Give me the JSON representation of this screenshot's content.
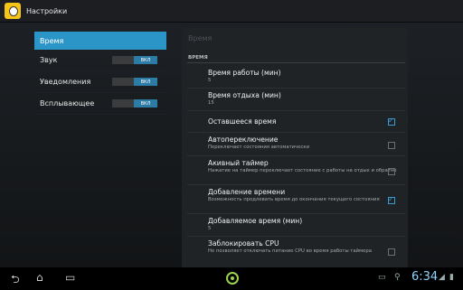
{
  "actionbar": {
    "title": "Настройки"
  },
  "left": {
    "header": "Время",
    "items": [
      {
        "label": "Звук",
        "toggle": "ВКЛ"
      },
      {
        "label": "Уведомления",
        "toggle": "ВКЛ"
      },
      {
        "label": "Всплывающее",
        "toggle": "ВКЛ"
      }
    ]
  },
  "right": {
    "title": "Время",
    "category": "ВРЕМЯ",
    "items": [
      {
        "title": "Время работы (мин)",
        "summary": "5"
      },
      {
        "title": "Время отдыха (мин)",
        "summary": "15"
      },
      {
        "title": "Оставшееся время",
        "summary": "",
        "checked": true
      },
      {
        "title": "Автопереключение",
        "summary": "Переключает состояния автоматически",
        "checked": false
      },
      {
        "title": "Акивный таймер",
        "summary": "Нажатие на таймер переключает состояние с работы на отдых и обратно",
        "checked": false
      },
      {
        "title": "Добавление времени",
        "summary": "Возможность продлевать время до окончания текущего состояния",
        "checked": true
      },
      {
        "title": "Добавляемое время (мин)",
        "summary": "5"
      },
      {
        "title": "Заблокировать CPU",
        "summary": "Не позволяет отключать питание CPU во время работы таймера",
        "checked": false
      }
    ]
  },
  "status": {
    "time": "6:34"
  },
  "icons": [
    "back-icon",
    "home-icon",
    "recent-apps-icon",
    "center-app-icon",
    "screen-icon",
    "usb-icon",
    "signal-icon",
    "battery-icon"
  ]
}
